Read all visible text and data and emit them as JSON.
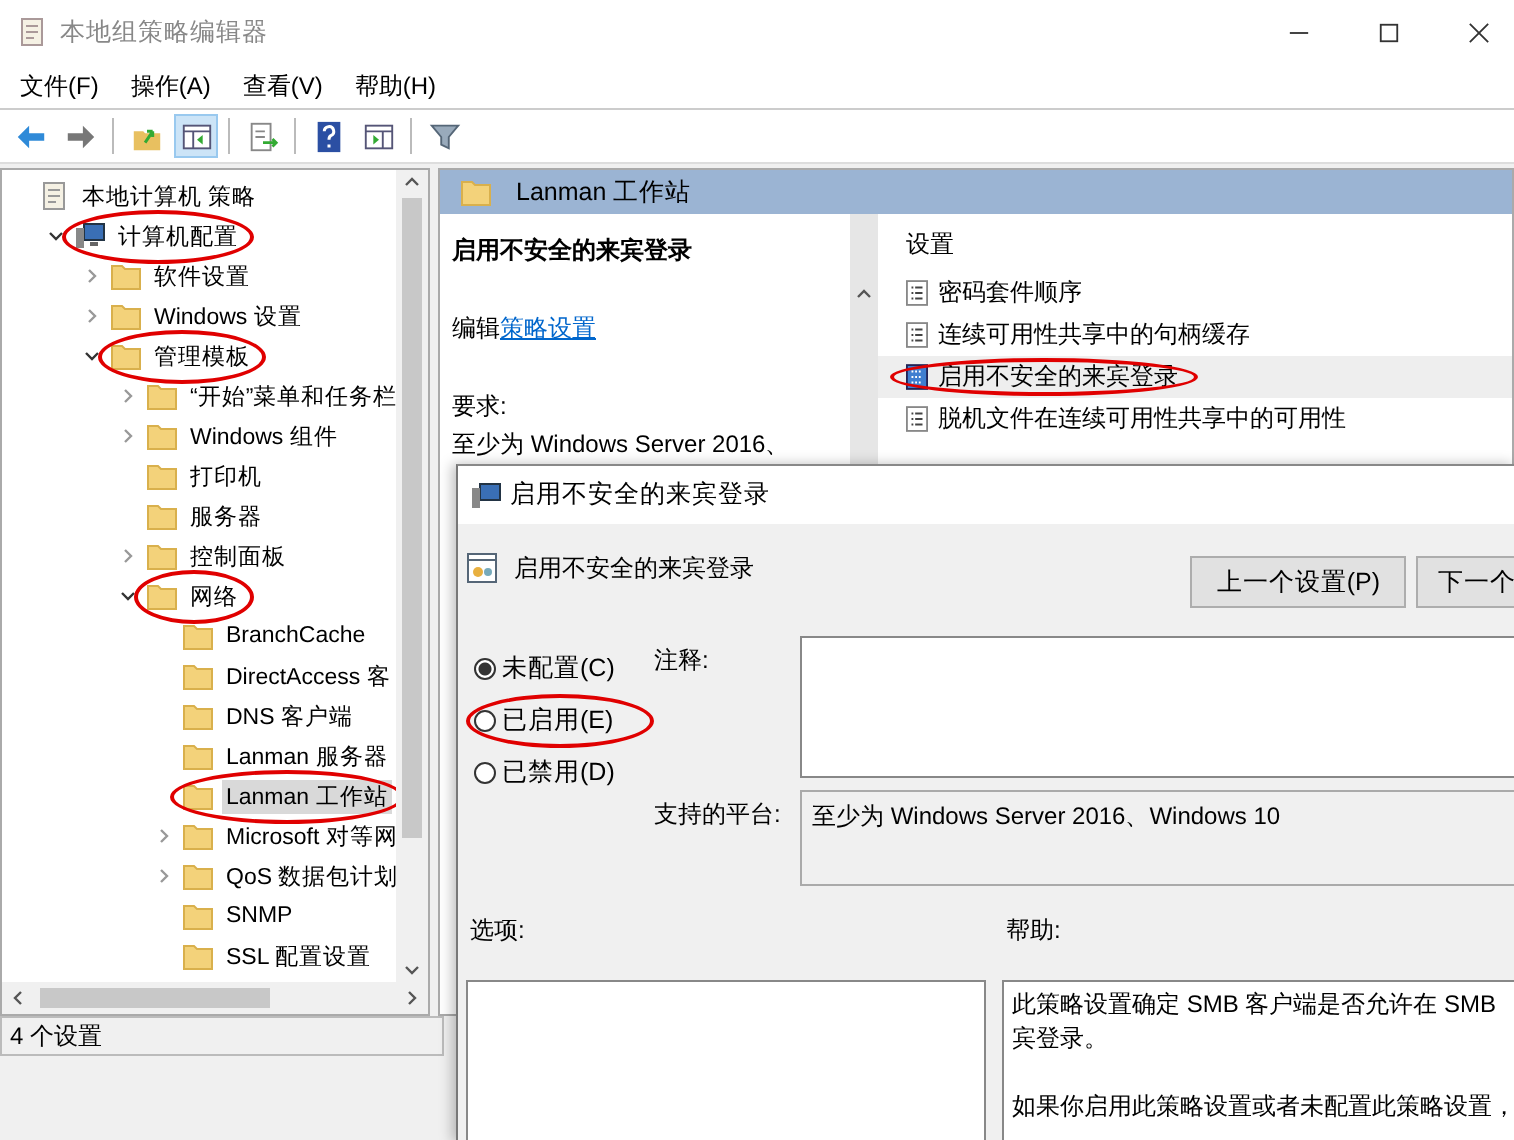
{
  "window": {
    "title": "本地组策略编辑器"
  },
  "menu": [
    "文件(F)",
    "操作(A)",
    "查看(V)",
    "帮助(H)"
  ],
  "toolbar": [
    {
      "kind": "back",
      "pressed": false
    },
    {
      "kind": "forward",
      "pressed": false
    },
    {
      "kind": "sep"
    },
    {
      "kind": "up",
      "pressed": false
    },
    {
      "kind": "pane",
      "pressed": true
    },
    {
      "kind": "sep"
    },
    {
      "kind": "export",
      "pressed": false
    },
    {
      "kind": "sep"
    },
    {
      "kind": "help",
      "pressed": false
    },
    {
      "kind": "panel",
      "pressed": false
    },
    {
      "kind": "sep"
    },
    {
      "kind": "filter",
      "pressed": false
    }
  ],
  "tree": {
    "items": [
      {
        "label": "本地计算机 策略",
        "kind": "policy",
        "selected": false,
        "circled": false,
        "children": [
          {
            "label": "计算机配置",
            "kind": "computer",
            "expanded": true,
            "selected": false,
            "circled": true,
            "children": [
              {
                "label": "软件设置",
                "kind": "folder",
                "expanded": false,
                "selected": false,
                "circled": false
              },
              {
                "label": "Windows 设置",
                "kind": "folder",
                "expanded": false,
                "selected": false,
                "circled": false
              },
              {
                "label": "管理模板",
                "kind": "folder",
                "expanded": true,
                "selected": false,
                "circled": true,
                "children": [
                  {
                    "label": "“开始”菜单和任务栏",
                    "kind": "folder",
                    "expanded": false,
                    "selected": false,
                    "circled": false
                  },
                  {
                    "label": "Windows 组件",
                    "kind": "folder",
                    "expanded": false,
                    "selected": false,
                    "circled": false
                  },
                  {
                    "label": "打印机",
                    "kind": "folder",
                    "selected": false,
                    "circled": false
                  },
                  {
                    "label": "服务器",
                    "kind": "folder",
                    "selected": false,
                    "circled": false
                  },
                  {
                    "label": "控制面板",
                    "kind": "folder",
                    "expanded": false,
                    "selected": false,
                    "circled": false
                  },
                  {
                    "label": "网络",
                    "kind": "folder",
                    "expanded": true,
                    "selected": false,
                    "circled": true,
                    "children": [
                      {
                        "label": "BranchCache",
                        "kind": "folder",
                        "selected": false,
                        "circled": false
                      },
                      {
                        "label": "DirectAccess 客",
                        "kind": "folder",
                        "selected": false,
                        "circled": false
                      },
                      {
                        "label": "DNS 客户端",
                        "kind": "folder",
                        "selected": false,
                        "circled": false
                      },
                      {
                        "label": "Lanman 服务器",
                        "kind": "folder",
                        "selected": false,
                        "circled": false
                      },
                      {
                        "label": "Lanman 工作站",
                        "kind": "folder",
                        "selected": true,
                        "circled": true
                      },
                      {
                        "label": "Microsoft 对等网",
                        "kind": "folder",
                        "expanded": false,
                        "selected": false,
                        "circled": false
                      },
                      {
                        "label": "QoS 数据包计划",
                        "kind": "folder",
                        "expanded": false,
                        "selected": false,
                        "circled": false
                      },
                      {
                        "label": "SNMP",
                        "kind": "folder",
                        "selected": false,
                        "circled": false
                      },
                      {
                        "label": "SSL 配置设置",
                        "kind": "folder",
                        "selected": false,
                        "circled": false
                      }
                    ]
                  }
                ]
              }
            ]
          }
        ]
      }
    ]
  },
  "status_bar": "4 个设置",
  "details": {
    "header": "Lanman 工作站",
    "title": "启用不安全的来宾登录",
    "edit_prefix": "编辑",
    "edit_link": "策略设置",
    "requirements_label": "要求:",
    "requirements": "至少为 Windows Server 2016、"
  },
  "settings": {
    "column": "设置",
    "items": [
      {
        "name": "密码套件顺序",
        "selected": false,
        "circled": false
      },
      {
        "name": "连续可用性共享中的句柄缓存",
        "selected": false,
        "circled": false
      },
      {
        "name": "启用不安全的来宾登录",
        "selected": true,
        "circled": true
      },
      {
        "name": "脱机文件在连续可用性共享中的可用性",
        "selected": false,
        "circled": false
      }
    ]
  },
  "dialog": {
    "title": "启用不安全的来宾登录",
    "setting_name": "启用不安全的来宾登录",
    "buttons": [
      "上一个设置(P)",
      "下一个"
    ],
    "options": [
      {
        "label": "未配置(C)",
        "selected": true,
        "circled": false
      },
      {
        "label": "已启用(E)",
        "selected": false,
        "circled": true
      },
      {
        "label": "已禁用(D)",
        "selected": false,
        "circled": false
      }
    ],
    "comment_label": "注释:",
    "platform_label": "支持的平台:",
    "platform": "至少为 Windows Server 2016、Windows 10",
    "options_label": "选项:",
    "help_label": "帮助:",
    "help": [
      [
        "此策略设置确定 SMB 客户端是否允许在 SMB",
        "宾登录。"
      ],
      [
        "如果你启用此策略设置或者未配置此策略设置，"
      ]
    ]
  }
}
